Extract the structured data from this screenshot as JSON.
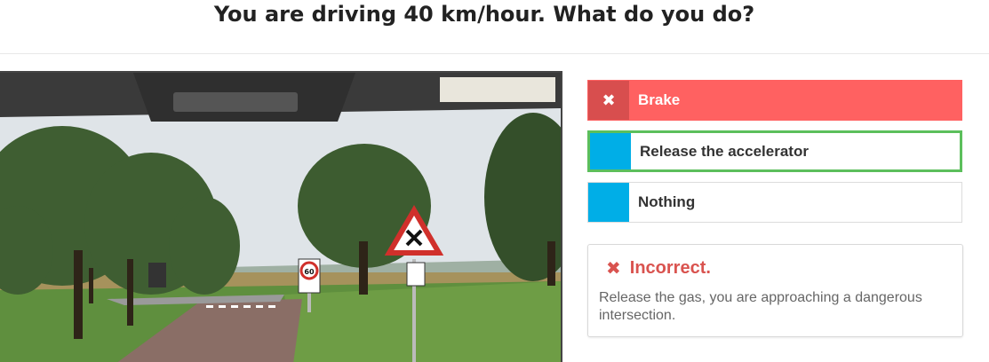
{
  "question": {
    "title": "You are driving 40 km/hour. What do you do?"
  },
  "scene": {
    "speed_sign_value": "60",
    "sky_color": "#dfe4e8",
    "road_color": "#8a6e66",
    "grass_color": "#5f8f3e"
  },
  "answers": [
    {
      "label": "Brake",
      "state": "selected-wrong",
      "marker_symbol": "✖"
    },
    {
      "label": "Release the accelerator",
      "state": "correct"
    },
    {
      "label": "Nothing",
      "state": "neutral"
    }
  ],
  "feedback": {
    "status": "Incorrect.",
    "icon": "close-icon",
    "message": "Release the gas, you are approaching a dangerous intersection.",
    "color": "#d9534f"
  },
  "colors": {
    "wrong": "#ff6161",
    "wrong_marker": "#d84e4e",
    "option_marker": "#00aee7",
    "correct_border": "#5cbf5c"
  }
}
